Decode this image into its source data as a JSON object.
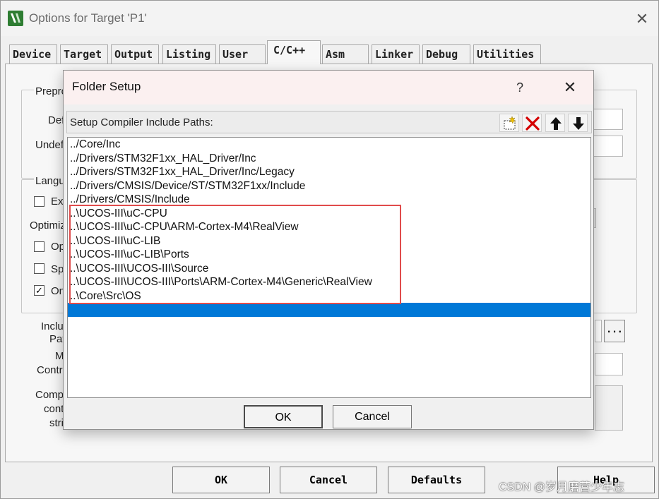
{
  "outer_window": {
    "title": "Options for Target 'P1'",
    "close_glyph": "✕",
    "tabs": [
      {
        "label": "Device"
      },
      {
        "label": "Target"
      },
      {
        "label": "Output"
      },
      {
        "label": "Listing"
      },
      {
        "label": "User"
      },
      {
        "label": "C/C++",
        "active": true
      },
      {
        "label": "Asm"
      },
      {
        "label": "Linker"
      },
      {
        "label": "Debug"
      },
      {
        "label": "Utilities"
      }
    ],
    "background_labels": {
      "preprocessor_group": "Prepro",
      "define": "Def",
      "undefine": "Undef",
      "language_group": "Langu",
      "execute_only": "Ex",
      "optimization": "Optimiz",
      "opt1": "Op",
      "opt2": "Sp",
      "opt3": "On",
      "include_paths": [
        "Inclu",
        "Pat"
      ],
      "misc_controls": [
        "M",
        "Contr"
      ],
      "compiler_string": [
        "Comp",
        "cont",
        "stri"
      ],
      "browse_button": "..."
    },
    "buttons": {
      "ok": "OK",
      "cancel": "Cancel",
      "defaults": "Defaults",
      "help": "Help"
    }
  },
  "folder_setup": {
    "title": "Folder Setup",
    "help_glyph": "?",
    "close_glyph": "✕",
    "list_label": "Setup Compiler Include Paths:",
    "toolbar": {
      "new_icon": "new-folder-icon",
      "delete_icon": "delete-icon",
      "move_up_icon": "arrow-up-icon",
      "move_down_icon": "arrow-down-icon"
    },
    "paths": [
      "../Core/Inc",
      "../Drivers/STM32F1xx_HAL_Driver/Inc",
      "../Drivers/STM32F1xx_HAL_Driver/Inc/Legacy",
      "../Drivers/CMSIS/Device/ST/STM32F1xx/Include",
      "../Drivers/CMSIS/Include",
      "..\\UCOS-III\\uC-CPU",
      "..\\UCOS-III\\uC-CPU\\ARM-Cortex-M4\\RealView",
      "..\\UCOS-III\\uC-LIB",
      "..\\UCOS-III\\uC-LIB\\Ports",
      "..\\UCOS-III\\UCOS-III\\Source",
      "..\\UCOS-III\\UCOS-III\\Ports\\ARM-Cortex-M4\\Generic\\RealView",
      "..\\Core\\Src\\OS",
      ""
    ],
    "selected_index": 12,
    "ok_label": "OK",
    "cancel_label": "Cancel"
  },
  "colors": {
    "selection": "#0078d7",
    "highlight_box": "#e04b4b",
    "delete_icon": "#d40000"
  },
  "watermark": "CSDN @岁月磨营少年志"
}
